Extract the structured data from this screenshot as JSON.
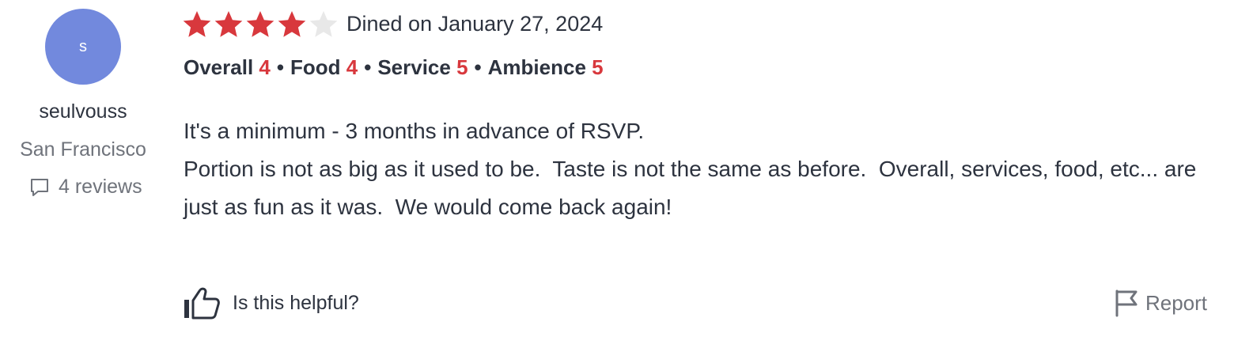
{
  "user": {
    "initial": "s",
    "name": "seulvouss",
    "location": "San Francisco",
    "reviews_count": "4 reviews",
    "avatar_color": "#7289dd"
  },
  "rating": {
    "stars": 4,
    "max_stars": 5,
    "dined_text": "Dined on January 27, 2024",
    "star_color": "#d8383d",
    "empty_star_color": "#e8e8e8"
  },
  "subratings": [
    {
      "label": "Overall",
      "value": "4"
    },
    {
      "label": "Food",
      "value": "4"
    },
    {
      "label": "Service",
      "value": "5"
    },
    {
      "label": "Ambience",
      "value": "5"
    }
  ],
  "review": {
    "lines": [
      "It's a minimum - 3 months in advance of RSVP.",
      "Portion is not as big as it used to be.  Taste is not the same as before.  Overall, services, food, etc... are just as fun as it was.  We would come back again!"
    ]
  },
  "footer": {
    "helpful_label": "Is this helpful?",
    "report_label": "Report",
    "helpful_icon": "thumbs-up-icon",
    "report_icon": "flag-icon"
  }
}
